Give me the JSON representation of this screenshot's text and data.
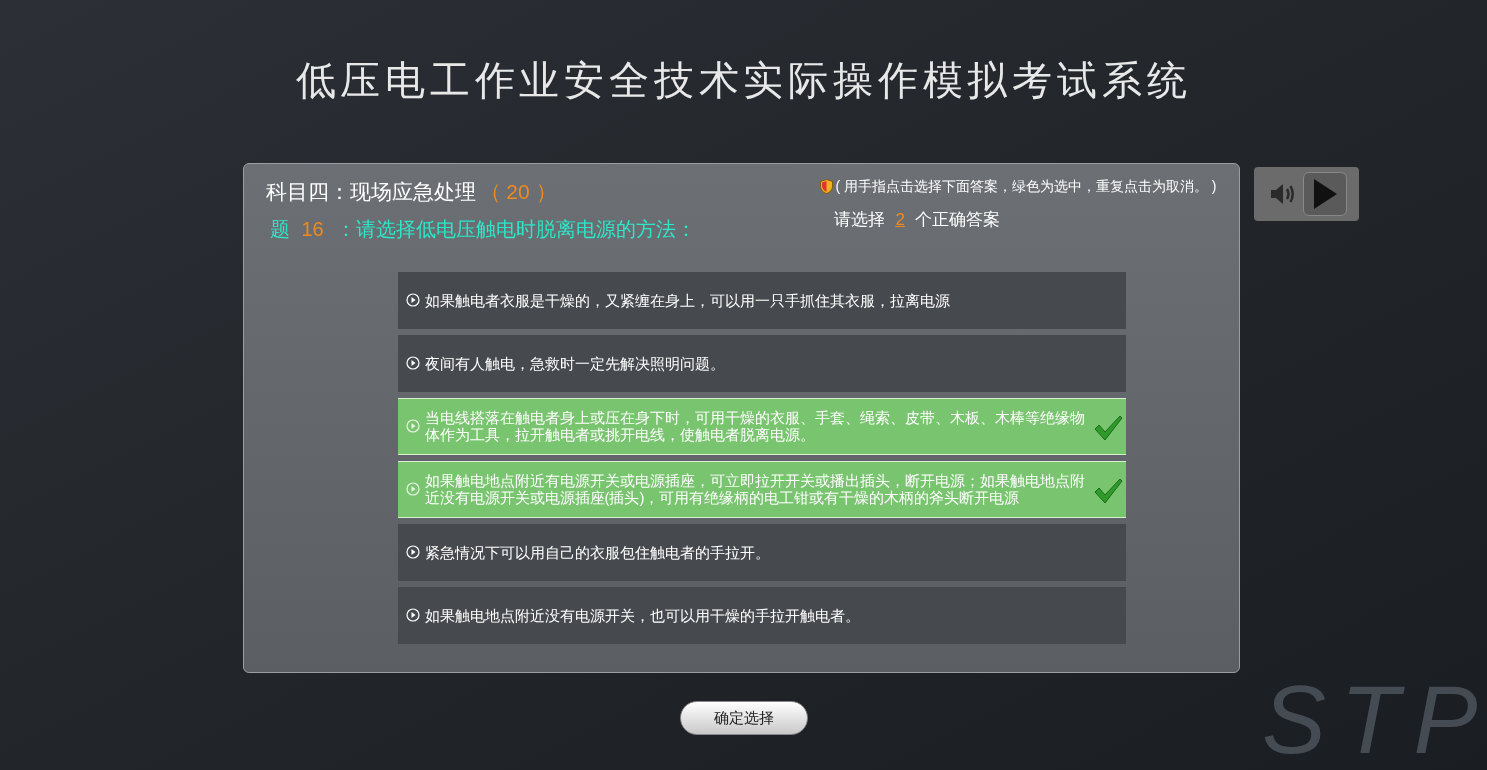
{
  "title": "低压电工作业安全技术实际操作模拟考试系统",
  "subject": {
    "label": "科目四：现场应急处理",
    "count": "（ 20 ）"
  },
  "question": {
    "prefix": "题",
    "number": "16",
    "text": "：请选择低电压触电时脱离电源的方法："
  },
  "hint": "( 用手指点击选择下面答案，绿色为选中，重复点击为取消。 )",
  "required": {
    "before": "请选择",
    "count": "2",
    "after": "个正确答案"
  },
  "options": [
    {
      "text": "如果触电者衣服是干燥的，又紧缠在身上，可以用一只手抓住其衣服，拉离电源",
      "selected": false
    },
    {
      "text": "夜间有人触电，急救时一定先解决照明问题。",
      "selected": false
    },
    {
      "text": "当电线搭落在触电者身上或压在身下时，可用干燥的衣服、手套、绳索、皮带、木板、木棒等绝缘物体作为工具，拉开触电者或挑开电线，使触电者脱离电源。",
      "selected": true
    },
    {
      "text": "如果触电地点附近有电源开关或电源插座，可立即拉开开关或播出插头，断开电源；如果触电地点附近没有电源开关或电源插座(插头)，可用有绝缘柄的电工钳或有干燥的木柄的斧头断开电源",
      "selected": true
    },
    {
      "text": "紧急情况下可以用自己的衣服包住触电者的手拉开。",
      "selected": false
    },
    {
      "text": "如果触电地点附近没有电源开关，也可以用干燥的手拉开触电者。",
      "selected": false
    }
  ],
  "confirm_button": "确定选择",
  "background_logo": "STP"
}
